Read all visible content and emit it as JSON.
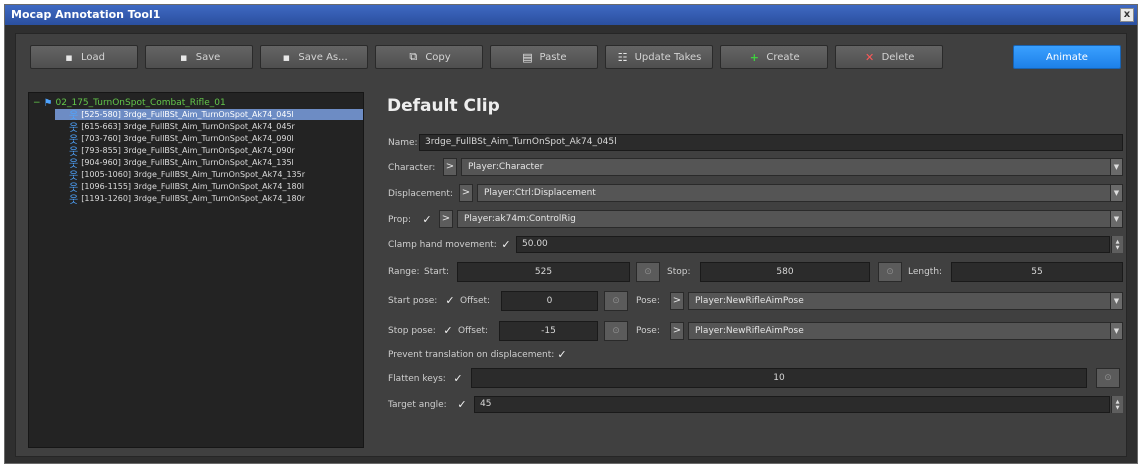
{
  "window": {
    "title": "Mocap Annotation Tool1",
    "close_glyph": "x"
  },
  "toolbar": {
    "load": {
      "label": "Load",
      "icon": "floppy-icon"
    },
    "save": {
      "label": "Save",
      "icon": "floppy-icon"
    },
    "save_as": {
      "label": "Save As...",
      "icon": "floppy-icon"
    },
    "copy": {
      "label": "Copy",
      "icon": "copy-icon"
    },
    "paste": {
      "label": "Paste",
      "icon": "paste-icon"
    },
    "update_takes": {
      "label": "Update Takes",
      "icon": "takes-icon"
    },
    "create": {
      "label": "Create",
      "icon": "plus-icon",
      "color": "#3fcf3f"
    },
    "delete": {
      "label": "Delete",
      "icon": "x-icon",
      "color": "#ff5858"
    },
    "animate": {
      "label": "Animate",
      "color": "#2a8ff5"
    }
  },
  "tree": {
    "root": {
      "label": "02_175_TurnOnSpot_Combat_Rifle_01",
      "expander": "−"
    },
    "items": [
      {
        "label": "[525-580] 3rdge_FullBSt_Aim_TurnOnSpot_Ak74_045l",
        "selected": true
      },
      {
        "label": "[615-663] 3rdge_FullBSt_Aim_TurnOnSpot_Ak74_045r"
      },
      {
        "label": "[703-760] 3rdge_FullBSt_Aim_TurnOnSpot_Ak74_090l"
      },
      {
        "label": "[793-855] 3rdge_FullBSt_Aim_TurnOnSpot_Ak74_090r"
      },
      {
        "label": "[904-960] 3rdge_FullBSt_Aim_TurnOnSpot_Ak74_135l"
      },
      {
        "label": "[1005-1060] 3rdge_FullBSt_Aim_TurnOnSpot_Ak74_135r"
      },
      {
        "label": "[1096-1155] 3rdge_FullBSt_Aim_TurnOnSpot_Ak74_180l"
      },
      {
        "label": "[1191-1260] 3rdge_FullBSt_Aim_TurnOnSpot_Ak74_180r"
      }
    ]
  },
  "clip": {
    "title": "Default Clip",
    "name_label": "Name:",
    "name_value": "3rdge_FullBSt_Aim_TurnOnSpot_Ak74_045l",
    "character_label": "Character:",
    "character_value": "Player:Character",
    "displacement_label": "Displacement:",
    "displacement_value": "Player:Ctrl:Displacement",
    "prop_label": "Prop:",
    "prop_checked": true,
    "prop_value": "Player:ak74m:ControlRig",
    "clamp_label": "Clamp hand movement:",
    "clamp_checked": true,
    "clamp_value": "50.00",
    "range_label": "Range:",
    "start_label": "Start:",
    "start_value": "525",
    "stop_label": "Stop:",
    "stop_value": "580",
    "length_label": "Length:",
    "length_value": "55",
    "start_pose_label": "Start pose:",
    "start_pose_checked": true,
    "start_offset_label": "Offset:",
    "start_offset_value": "0",
    "pose_label": "Pose:",
    "start_pose_value": "Player:NewRifleAimPose",
    "stop_pose_label": "Stop pose:",
    "stop_pose_checked": true,
    "stop_offset_label": "Offset:",
    "stop_offset_value": "-15",
    "stop_pose_value": "Player:NewRifleAimPose",
    "prevent_label": "Prevent translation on displacement:",
    "prevent_checked": true,
    "flatten_label": "Flatten keys:",
    "flatten_checked": true,
    "flatten_value": "10",
    "target_label": "Target angle:",
    "target_checked": true,
    "target_value": "45",
    "arrow_glyph": ">",
    "check_glyph": "✓",
    "pick_glyph": "⊙",
    "drop_glyph": "▼"
  }
}
